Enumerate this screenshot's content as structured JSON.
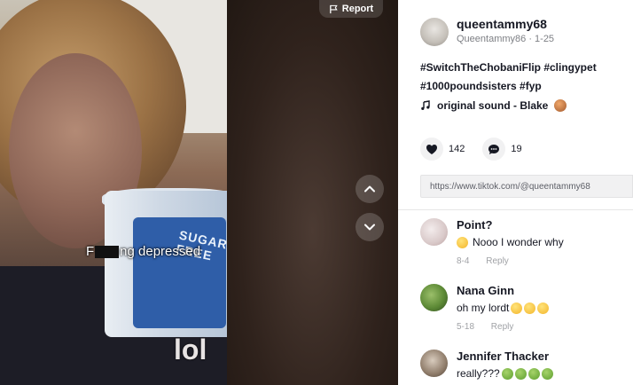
{
  "video": {
    "caption_text_before": "F",
    "caption_text_after": "ng depressed",
    "overlay_text": "lol",
    "tub_text": "SUGAR FREE",
    "report_label": "Report"
  },
  "post": {
    "username": "queentammy68",
    "subline": "Queentammy86 · 1-25",
    "description_line1": "#SwitchTheChobaniFlip #clingypet",
    "description_line2": "#1000poundsisters #fyp",
    "music": "original sound - Blake",
    "likes": "142",
    "comments": "19",
    "link": "https://www.tiktok.com/@queentammy68"
  },
  "comments": [
    {
      "name": "Point?",
      "text": "Nooo I wonder why",
      "date": "8-4",
      "reply": "Reply"
    },
    {
      "name": "Nana Ginn",
      "text": "oh my lordt",
      "date": "5-18",
      "reply": "Reply"
    },
    {
      "name": "Jennifer Thacker",
      "text": "really???",
      "date": "",
      "reply": ""
    }
  ],
  "colors": {
    "text_primary": "#161823",
    "text_secondary": "#7d7f84",
    "side_bg": "#ffffff",
    "video_bg": "#2e1d17"
  },
  "icons": {
    "report": "flag-icon",
    "up": "chevron-up-icon",
    "down": "chevron-down-icon",
    "music": "music-note-icon",
    "like": "heart-icon",
    "comment": "comment-icon"
  }
}
